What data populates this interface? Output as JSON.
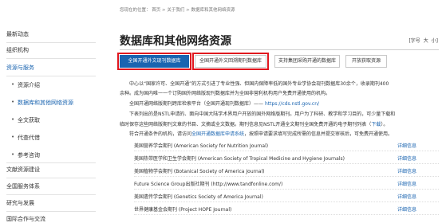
{
  "sidebar": {
    "items": [
      {
        "label": "最新动态",
        "sub": false,
        "active": false
      },
      {
        "label": "组织机构",
        "sub": false,
        "active": false
      },
      {
        "label": "资源与服务",
        "sub": false,
        "active": true
      },
      {
        "label": "资源介绍",
        "sub": true,
        "active": false
      },
      {
        "label": "数据库和其他网络资源",
        "sub": true,
        "active": true
      },
      {
        "label": "全文获取",
        "sub": true,
        "active": false
      },
      {
        "label": "代查代借",
        "sub": true,
        "active": false
      },
      {
        "label": "参考咨询",
        "sub": true,
        "active": false
      },
      {
        "label": "文献资源建设",
        "sub": false,
        "active": false
      },
      {
        "label": "全国服务体系",
        "sub": false,
        "active": false
      },
      {
        "label": "研究与发展",
        "sub": false,
        "active": false
      },
      {
        "label": "国际合作与交流",
        "sub": false,
        "active": false
      }
    ]
  },
  "breadcrumb": {
    "text": "您现在的位置：  首页 > 关于我们 > 数据库和其他网络资源"
  },
  "header": {
    "title": "数据库和其他网络资源",
    "font_label": "[字号",
    "font_large": "大",
    "font_small": "小]"
  },
  "tabs": [
    {
      "label": "全国开通外文现刊数据库",
      "active": true
    },
    {
      "label": "全国开通外文回溯期刊数据库",
      "active": false
    },
    {
      "label": "支持集团采购开通的数据库",
      "active": false
    },
    {
      "label": "开放获取资源",
      "active": false
    }
  ],
  "content": {
    "intro_1": "中心以“国家许可、全国开通”的方式引进了专业性强、但国内保障率低的国外专业学协会现刊数据库30余个，收录期刊400",
    "intro_2": "余种。成为国内唯一一个订购国外网络版现刊数据库并为全国非营利机构用户免费开通使用的机构。",
    "portal_prefix": "全国开通网络版期刊跨库检索平台（全国开通现刊数据库）——",
    "portal_url": "https://cds.nstl.gov.cn/",
    "pdf_1": "下表列出的是NSTL申请的、面向中国大陆学术界用户开放的国外网络版期刊。用户为了科研、教学和学习目的，可少量下载和",
    "pdf_2_prefix": "临时保存这些网络版期刊文章的书目、文摘或全文数据。期刊信息见NSTL开通全文期刊全国免费开通的电子期刊列表（",
    "pdf_download": "下载",
    "pdf_2_suffix": "）。",
    "apply_prefix": "符合开通条件的机构，请访问",
    "apply_link": "全国开通数据库申请系统",
    "apply_suffix": "，按照申请要求填写完成所需的信息并提交审核后，可免费开通使用。"
  },
  "databases": [
    {
      "name": "美国营养学会期刊 (American Society for Nutrition Journal)",
      "more": "详细信息"
    },
    {
      "name": "美国热带医学和卫生学会期刊 (American Society of Tropical Medicine and Hygiene Journals)",
      "more": "详细信息"
    },
    {
      "name": "美国植物学会期刊 (Botanical Society of America Journal)",
      "more": "详细信息"
    },
    {
      "name": "Future Science Group出版社期刊 (http://www.tandfonline.com/)",
      "more": "详细信息"
    },
    {
      "name": "美国遗传学会期刊 (Genetics Society of America Journal)",
      "more": "详细信息"
    },
    {
      "name": "世界健康基金会期刊 (Project HOPE Journal)",
      "more": "详细信息"
    }
  ],
  "colors": {
    "accent": "#1a64b0",
    "highlight_border": "#e0161e",
    "text": "#333333"
  }
}
